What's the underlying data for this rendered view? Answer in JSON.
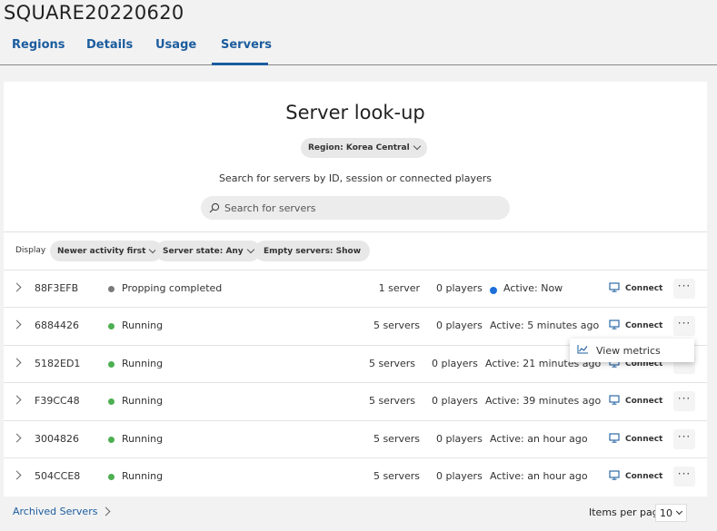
{
  "page": {
    "title": "SQUARE20220620"
  },
  "tabs": [
    {
      "label": "Regions"
    },
    {
      "label": "Details"
    },
    {
      "label": "Usage"
    },
    {
      "label": "Servers",
      "active": true
    }
  ],
  "lookup": {
    "heading": "Server look-up",
    "region_label": "Region: Korea Central",
    "search_hint": "Search for servers by ID, session or connected players",
    "search_placeholder": "Search for servers",
    "search_value": ""
  },
  "filters": {
    "display_label": "Display",
    "sort": "Newer activity first",
    "server_state": "Server state: Any",
    "empty_servers": "Empty servers: Show"
  },
  "rows": [
    {
      "id": "88F3EFB",
      "status": "Propping completed",
      "status_color": "#7a7a7a",
      "servers": "1 server",
      "players": "0 players",
      "activity": "Active: Now",
      "activity_dot": true,
      "connect": "Connect"
    },
    {
      "id": "6884426",
      "status": "Running",
      "status_color": "#4caf50",
      "servers": "5 servers",
      "players": "0 players",
      "activity": "Active: 5 minutes ago",
      "connect": "Connect"
    },
    {
      "id": "5182ED1",
      "status": "Running",
      "status_color": "#4caf50",
      "servers": "5 servers",
      "players": "0 players",
      "activity": "Active: 21 minutes ago",
      "connect": "Connect"
    },
    {
      "id": "F39CC48",
      "status": "Running",
      "status_color": "#4caf50",
      "servers": "5 servers",
      "players": "0 players",
      "activity": "Active: 39 minutes ago",
      "connect": "Connect"
    },
    {
      "id": "3004826",
      "status": "Running",
      "status_color": "#4caf50",
      "servers": "5 servers",
      "players": "0 players",
      "activity": "Active: an hour ago",
      "connect": "Connect"
    },
    {
      "id": "504CCE8",
      "status": "Running",
      "status_color": "#4caf50",
      "servers": "5 servers",
      "players": "0 players",
      "activity": "Active: an hour ago",
      "connect": "Connect"
    }
  ],
  "context_menu": {
    "item": "View metrics"
  },
  "footer": {
    "archived": "Archived Servers",
    "items_per_page_label": "Items per page",
    "items_per_page_value": "10"
  },
  "colors": {
    "accent": "#1b5c9e",
    "running": "#4caf50",
    "active_now": "#1e6fd9"
  },
  "more_glyph": "···"
}
